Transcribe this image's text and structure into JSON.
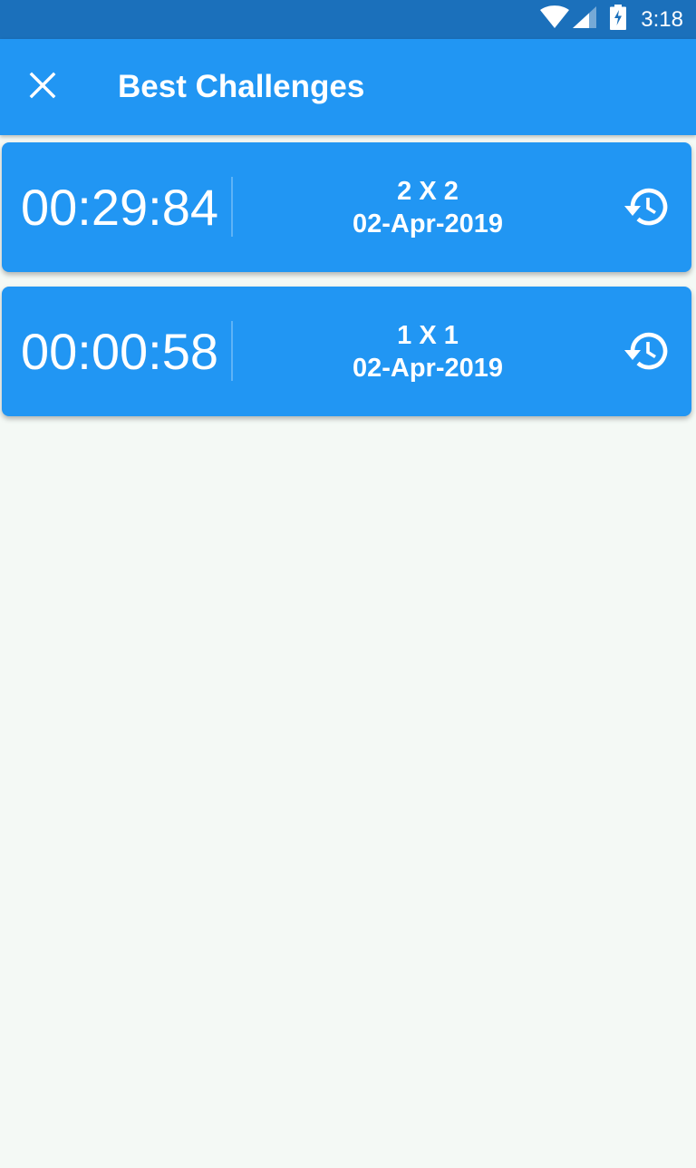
{
  "status_bar": {
    "time": "3:18",
    "icons": [
      "wifi-icon",
      "signal-icon",
      "battery-charging-icon"
    ],
    "color": "#1b70bb"
  },
  "app_bar": {
    "title": "Best Challenges",
    "close_icon": "close-icon",
    "color": "#2196f3"
  },
  "records": [
    {
      "time": "00:29:84",
      "grid": "2 X 2",
      "date": "02-Apr-2019",
      "icon": "history-icon"
    },
    {
      "time": "00:00:58",
      "grid": "1 X 1",
      "date": "02-Apr-2019",
      "icon": "history-icon"
    }
  ]
}
